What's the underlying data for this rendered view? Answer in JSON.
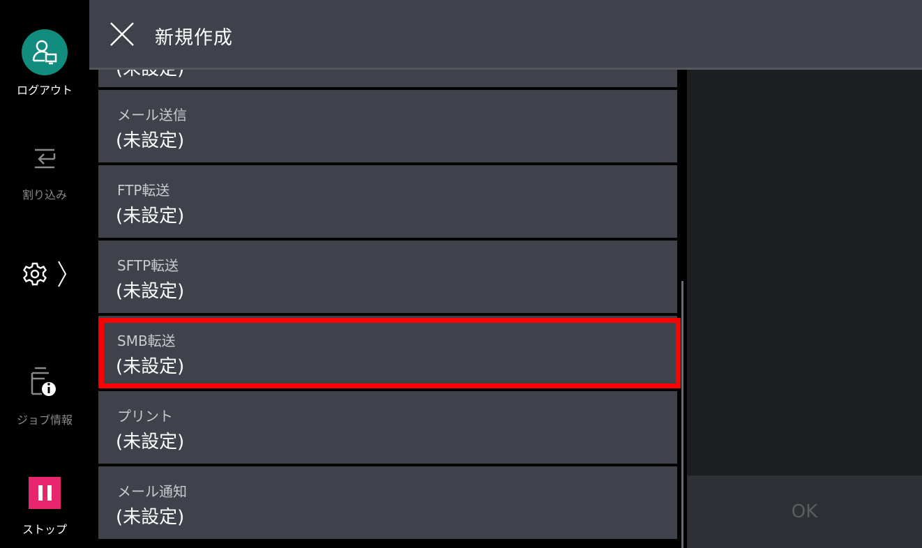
{
  "sidebar": {
    "logout_label": "ログアウト",
    "interrupt_label": "割り込み",
    "job_info_label": "ジョブ情報",
    "stop_label": "ストップ"
  },
  "header": {
    "title": "新規作成"
  },
  "list": {
    "partial_value": "(未設定)",
    "items": [
      {
        "label": "メール送信",
        "value": "(未設定)"
      },
      {
        "label": "FTP転送",
        "value": "(未設定)"
      },
      {
        "label": "SFTP転送",
        "value": "(未設定)"
      },
      {
        "label": "SMB転送",
        "value": "(未設定)"
      },
      {
        "label": "プリント",
        "value": "(未設定)"
      },
      {
        "label": "メール通知",
        "value": "(未設定)"
      }
    ]
  },
  "footer": {
    "ok_label": "OK"
  },
  "colors": {
    "accent_teal": "#128c7e",
    "stop_pink": "#e8266d",
    "highlight_red": "#ff0000",
    "panel": "#3f424a"
  }
}
